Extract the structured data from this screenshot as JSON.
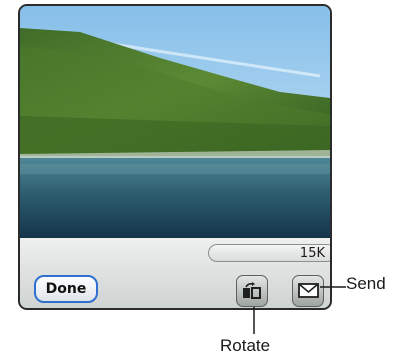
{
  "photo": {
    "subject": "forested mountain slope above a lake under blue sky",
    "colors": {
      "sky_top": "#8fc3ea",
      "sky_bottom": "#cfe7f8",
      "forest_dark": "#2f5a1e",
      "forest_light": "#6c9a3a",
      "water_top": "#4d7f8f",
      "water_bottom": "#17384a"
    }
  },
  "status": {
    "size_label": "15K"
  },
  "toolbar": {
    "done_label": "Done",
    "rotate_icon": "rotate-icon",
    "send_icon": "envelope-icon"
  },
  "callouts": {
    "send": "Send",
    "rotate": "Rotate"
  },
  "colors": {
    "done_border": "#2e6fd0",
    "frame": "#2b2b2b"
  }
}
